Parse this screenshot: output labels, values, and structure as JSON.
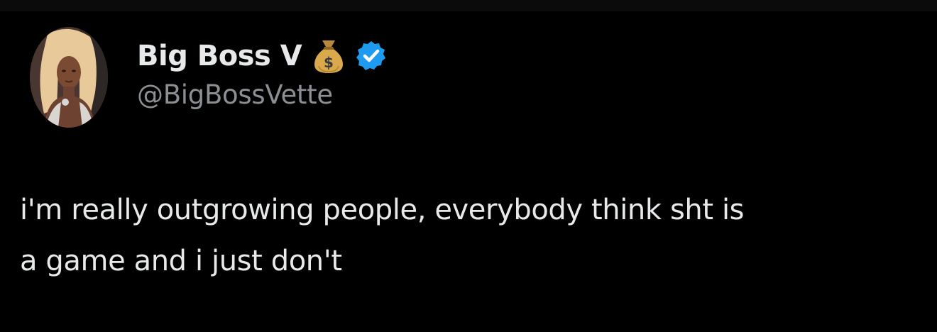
{
  "tweet": {
    "author": {
      "display_name": "Big Boss V",
      "name_emoji": "money-bag",
      "verified": true,
      "handle": "@BigBossVette"
    },
    "text_lines": [
      "i'm really outgrowing people, everybody think sht is",
      "a game and i just don't"
    ]
  },
  "colors": {
    "background": "#000000",
    "primary_text": "#e7e9ea",
    "secondary_text": "#8b8f94",
    "verified_blue": "#1d9bf0"
  }
}
